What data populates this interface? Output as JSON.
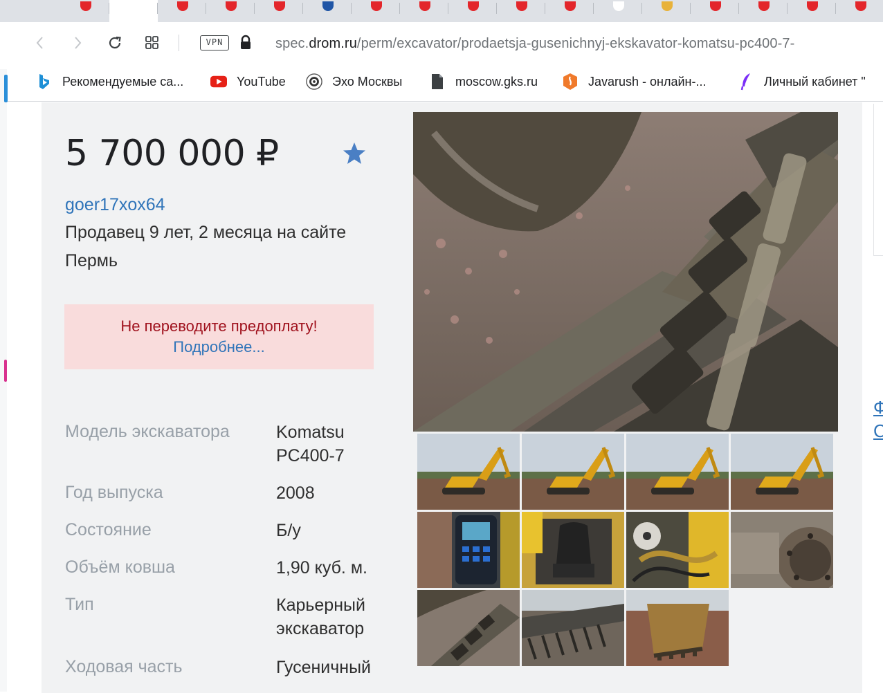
{
  "browser": {
    "url_prefix": "spec.",
    "url_host": "drom.ru",
    "url_path": "/perm/excavator/prodaetsja-gusenichnyj-ekskavator-komatsu-pc400-7-",
    "vpn_label": "VPN",
    "tab_favicon_colors": [
      "#e3262b",
      "#ffffff",
      "#e3262b",
      "#e3262b",
      "#e3262b",
      "#1f55a6",
      "#e3262b",
      "#e3262b",
      "#e3262b",
      "#e3262b",
      "#e3262b",
      "#ffffff",
      "#e8b23a",
      "#e3262b",
      "#e3262b",
      "#e3262b",
      "#e3262b",
      "#e3262b"
    ],
    "bookmarks": [
      {
        "label": "Рекомендуемые са...",
        "icon": "bing-icon"
      },
      {
        "label": "YouTube",
        "icon": "youtube-icon"
      },
      {
        "label": "Эхо Москвы",
        "icon": "echo-icon"
      },
      {
        "label": "moscow.gks.ru",
        "icon": "document-icon"
      },
      {
        "label": "Javarush - онлайн-...",
        "icon": "javarush-icon"
      },
      {
        "label": "Личный кабинет \"",
        "icon": "feather-icon"
      }
    ]
  },
  "listing": {
    "price": "5 700 000 ₽",
    "seller_name": "goer17xox64",
    "seller_since": "Продавец 9 лет, 2 месяца на сайте",
    "city": "Пермь",
    "warning_text": "Не переводите предоплату!",
    "warning_link": "Подробнее...",
    "specs": [
      {
        "label": "Модель экскаватора",
        "value": "Komatsu PC400-7"
      },
      {
        "label": "Год выпуска",
        "value": "2008"
      },
      {
        "label": "Состояние",
        "value": "Б/у"
      },
      {
        "label": "Объём ковша",
        "value": "1,90 куб. м."
      },
      {
        "label": "Тип",
        "value": "Карьерный экскаватор"
      },
      {
        "label": "Ходовая часть",
        "value": "Гусеничный"
      }
    ],
    "thumbnails_count": 11
  },
  "right_edge_letters": "Ф\nС",
  "colors": {
    "accent_link": "#2f74b9",
    "warning_bg": "#f9dcdc",
    "warning_text": "#a0121e",
    "star": "#4a7fc4"
  }
}
